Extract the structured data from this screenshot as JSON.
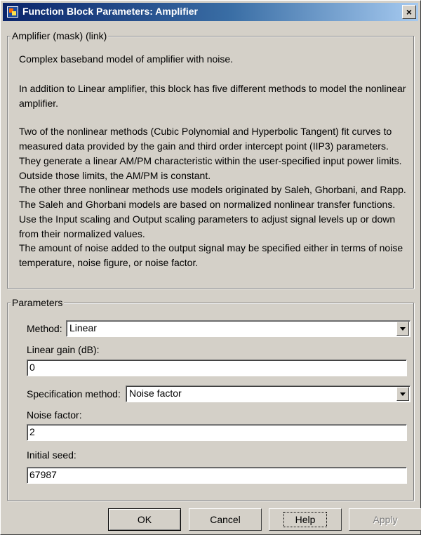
{
  "window": {
    "title": "Function Block Parameters: Amplifier",
    "close_label": "×"
  },
  "description": {
    "legend": "Amplifier (mask) (link)",
    "paragraphs": [
      "Complex baseband model of amplifier with noise.",
      "In addition to Linear amplifier, this block has five different methods to model the nonlinear amplifier.",
      "Two of the nonlinear methods (Cubic Polynomial and Hyperbolic Tangent) fit curves to measured data provided by the gain and third order intercept point (IIP3) parameters. They generate a linear AM/PM characteristic within the user-specified input power limits.  Outside those limits, the AM/PM is constant.",
      "The other three nonlinear methods use models originated by Saleh, Ghorbani, and Rapp.  The Saleh and Ghorbani models are based on normalized nonlinear transfer functions.  Use the Input scaling and Output scaling parameters to adjust signal levels up or down from their normalized values.",
      "The amount of noise added to the output signal may be specified either in terms of noise temperature, noise figure, or noise factor."
    ]
  },
  "parameters": {
    "legend": "Parameters",
    "method_label": "Method:",
    "method_value": "Linear",
    "linear_gain_label": "Linear gain (dB):",
    "linear_gain_value": "0",
    "spec_method_label": "Specification method:",
    "spec_method_value": "Noise factor",
    "noise_factor_label": "Noise factor:",
    "noise_factor_value": "2",
    "initial_seed_label": "Initial seed:",
    "initial_seed_value": "67987"
  },
  "buttons": {
    "ok": "OK",
    "cancel": "Cancel",
    "help": "Help",
    "apply": "Apply"
  },
  "icons": {
    "app": "simulink-block-icon",
    "close": "close-icon",
    "dropdown": "chevron-down-icon"
  }
}
